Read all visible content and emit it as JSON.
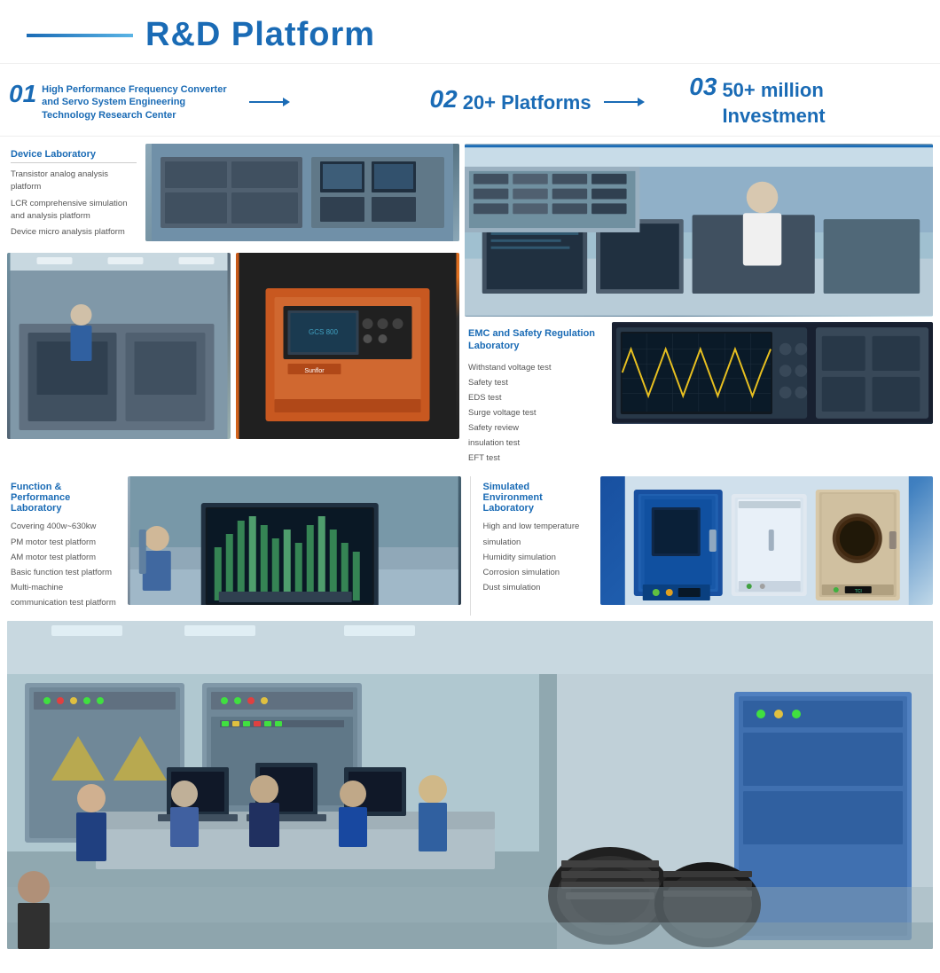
{
  "header": {
    "title": "R&D Platform",
    "line_color": "#1a6bb5"
  },
  "badges": [
    {
      "num": "01",
      "text_line1": "High Performance Frequency Converter and Servo System Engineering",
      "text_line2": "Technology Research Center",
      "large": false
    },
    {
      "num": "02",
      "text": "20+ Platforms",
      "large": true
    },
    {
      "num": "03",
      "text": "50+ million Investment",
      "large": true
    }
  ],
  "device_lab": {
    "title": "Device Laboratory",
    "items": [
      "Transistor analog analysis platform",
      "LCR comprehensive simulation and analysis platform",
      "Device micro analysis platform"
    ]
  },
  "emc_lab": {
    "title": "EMC and Safety Regulation Laboratory",
    "items": [
      "Withstand voltage test",
      "Safety test",
      "EDS test",
      "Surge voltage test",
      "Safety review",
      "insulation test",
      "EFT test"
    ]
  },
  "function_lab": {
    "title": "Function & Performance Laboratory",
    "items": [
      "Covering 400w~630kw",
      "PM motor test platform",
      "AM motor test platform",
      "Basic function test platform",
      "Multi-machine communication test platform"
    ]
  },
  "simulated_lab": {
    "title": "Simulated Environment Laboratory",
    "items": [
      "High and low temperature simulation",
      "Humidity simulation",
      "Corrosion simulation",
      "Dust simulation"
    ]
  }
}
